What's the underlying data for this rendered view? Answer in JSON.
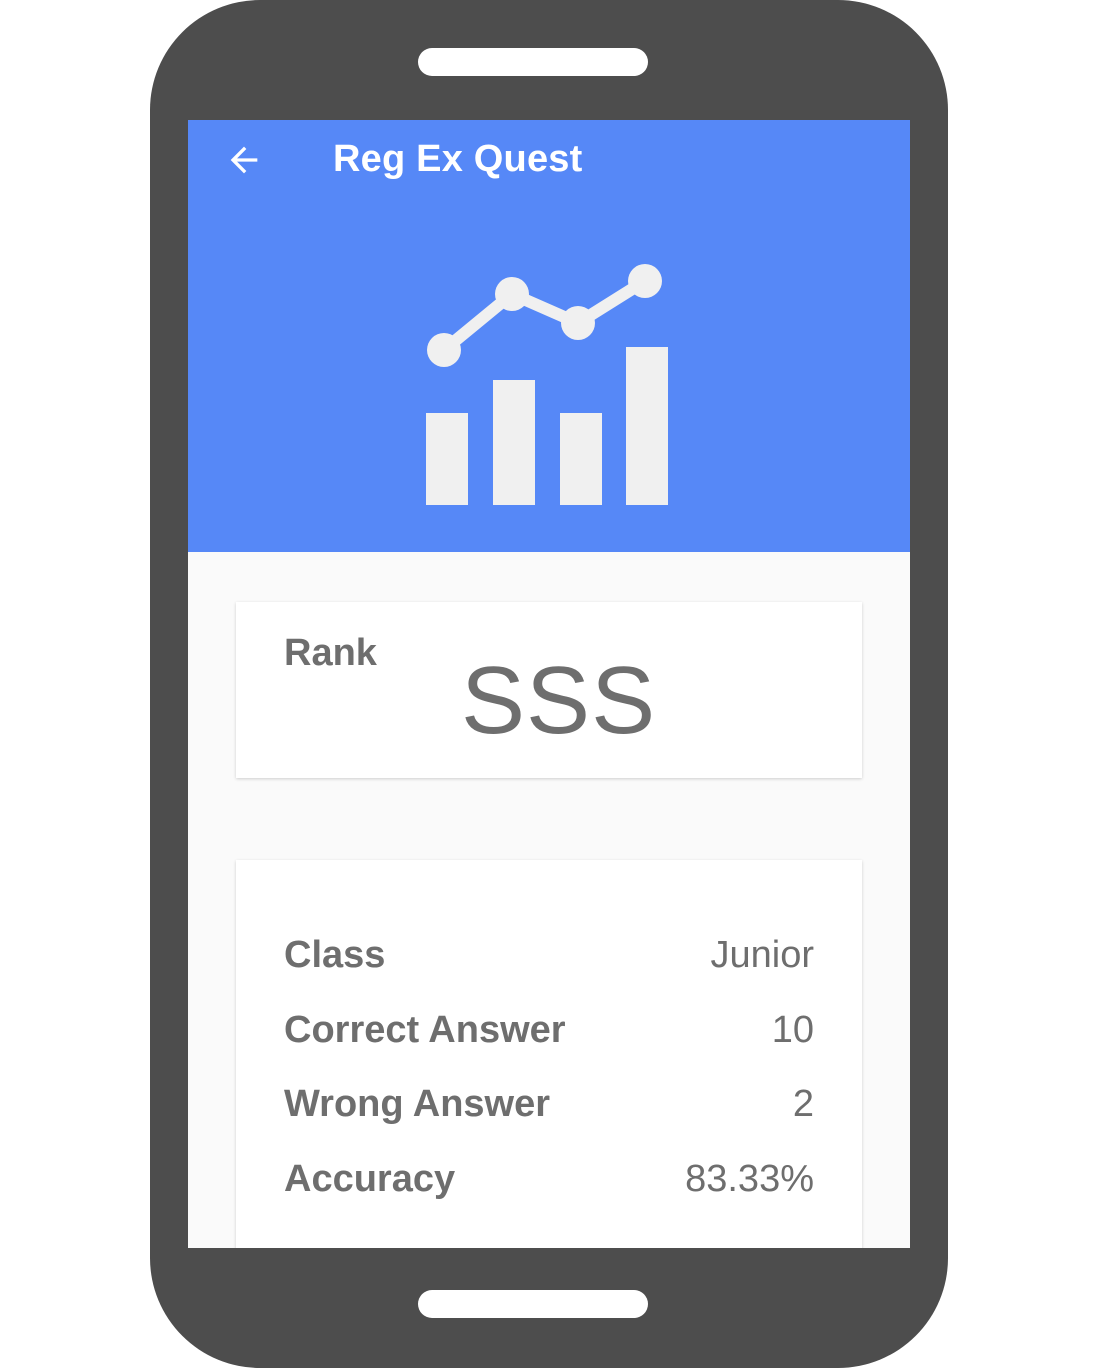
{
  "app_bar": {
    "title": "Reg Ex Quest",
    "back_icon": "arrow-left-icon"
  },
  "hero": {
    "icon": "analytics-chart-icon"
  },
  "rank": {
    "label": "Rank",
    "value": "SSS"
  },
  "stats": [
    {
      "label": "Class",
      "value": "Junior"
    },
    {
      "label": "Correct Answer",
      "value": "10"
    },
    {
      "label": "Wrong Answer",
      "value": "2"
    },
    {
      "label": "Accuracy",
      "value": "83.33%"
    }
  ],
  "colors": {
    "primary": "#5688f7",
    "device": "#4d4d4d",
    "text": "#6e6e6e",
    "icon": "#f0f0f0"
  }
}
